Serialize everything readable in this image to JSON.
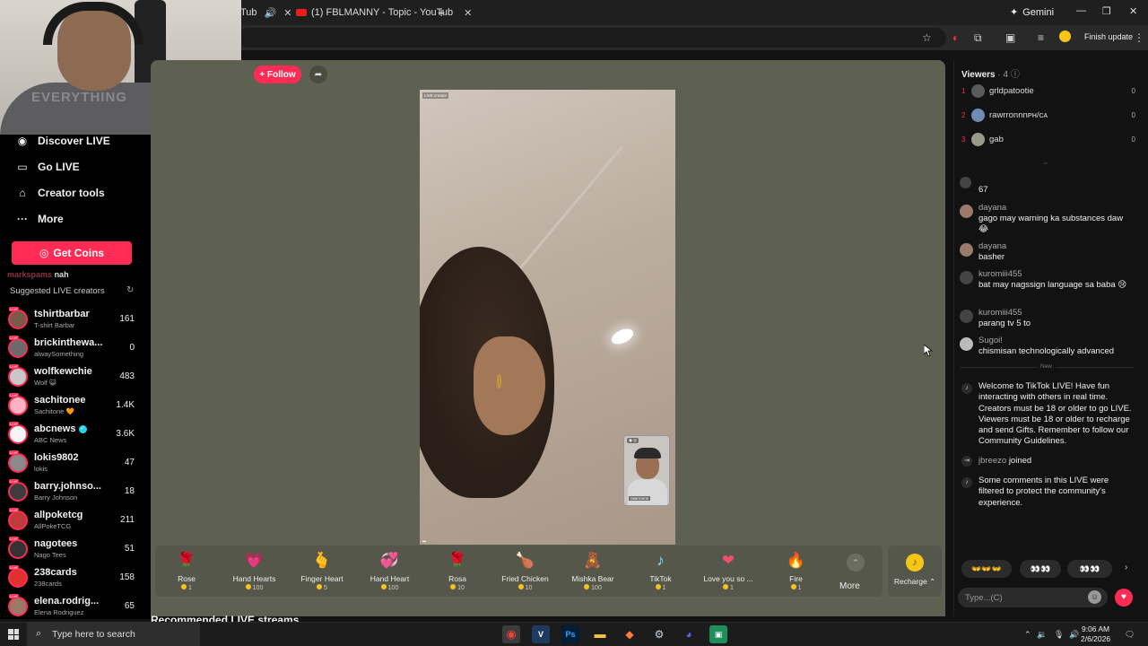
{
  "browser": {
    "tabs": [
      {
        "title": "Tub"
      },
      {
        "title": "(1) FBLMANNY - Topic - YouTub"
      }
    ],
    "gemini_label": "Gemini",
    "finish_update": "Finish update"
  },
  "sidebar": {
    "nav": [
      {
        "label": "Discover LIVE",
        "icon": "broadcast-icon"
      },
      {
        "label": "Go LIVE",
        "icon": "camera-icon"
      },
      {
        "label": "Creator tools",
        "icon": "home-icon"
      },
      {
        "label": "More",
        "icon": "more-icon"
      }
    ],
    "get_coins": "Get Coins",
    "handle_text": "marks",
    "handle_text_faded": "pams",
    "handle_text_end": "nah",
    "suggested_header": "Suggested LIVE creators",
    "live_badge": "LIVE",
    "creators": [
      {
        "name": "tshirtbarbar",
        "sub": "T-shirt Barbar",
        "count": "161"
      },
      {
        "name": "brickinthewa...",
        "sub": "alwaySomething",
        "count": "0"
      },
      {
        "name": "wolfkewchie",
        "sub": "Wolf 😺",
        "count": "483"
      },
      {
        "name": "sachitonee",
        "sub": "Sachitone 🧡",
        "count": "1.4K"
      },
      {
        "name": "abcnews",
        "sub": "ABC News",
        "count": "3.6K",
        "verified": true
      },
      {
        "name": "lokis9802",
        "sub": "lokis",
        "count": "47"
      },
      {
        "name": "barry.johnso...",
        "sub": "Barry Johnson",
        "count": "18"
      },
      {
        "name": "allpoketcg",
        "sub": "AllPokeTCG",
        "count": "211"
      },
      {
        "name": "nagotees",
        "sub": "Nago Tees",
        "count": "51"
      },
      {
        "name": "238cards",
        "sub": "238cards",
        "count": "158"
      },
      {
        "name": "elena.rodrig...",
        "sub": "Elena Rodriguez",
        "count": "65"
      }
    ]
  },
  "webcam": {
    "shirt_text": "EVERYTHING"
  },
  "stream": {
    "follow_label": "+ Follow",
    "video_label": "LIVE creator",
    "guest_top": "◉ ◎",
    "guest_name": "rawrronnn"
  },
  "gifts": [
    {
      "name": "Rose",
      "price": "1",
      "icon": "🌹"
    },
    {
      "name": "Hand Hearts",
      "price": "100",
      "icon": "💗"
    },
    {
      "name": "Finger Heart",
      "price": "5",
      "icon": "🫰"
    },
    {
      "name": "Hand Heart",
      "price": "100",
      "icon": "💞"
    },
    {
      "name": "Rosa",
      "price": "10",
      "icon": "🌹"
    },
    {
      "name": "Fried Chicken",
      "price": "10",
      "icon": "🍗"
    },
    {
      "name": "Mishka Bear",
      "price": "100",
      "icon": "🧸"
    },
    {
      "name": "TikTok",
      "price": "1",
      "icon": "♪"
    },
    {
      "name": "Love you so ...",
      "price": "1",
      "icon": "❤"
    },
    {
      "name": "Fire",
      "price": "1",
      "icon": "🔥"
    }
  ],
  "more_label": "More",
  "recharge_label": "Recharge ⌃",
  "recommended_label": "Recommended LIVE streams",
  "viewers": {
    "title": "Viewers",
    "count": "· 4",
    "list": [
      {
        "rank": "1",
        "name": "grldpatootie",
        "score": "0"
      },
      {
        "rank": "2",
        "name": "rawrronnnᴘʜ/ᴄᴀ",
        "score": "0"
      },
      {
        "rank": "3",
        "name": "gab",
        "score": "0"
      }
    ]
  },
  "chat": {
    "first_item": "67",
    "messages": [
      {
        "user": "dayana",
        "text": "gago may warning ka substances daw 😂"
      },
      {
        "user": "dayana",
        "text": "basher"
      },
      {
        "user": "kuromiii455",
        "text": "bat may nagssign language sa baba 😢"
      },
      {
        "user": "kuromiii455",
        "text": "parang tv 5 to"
      },
      {
        "user": "Sugoi!",
        "text": "chismisan technologically advanced"
      }
    ],
    "new_label": "New",
    "welcome": "Welcome to TikTok LIVE! Have fun interacting with others in real time. Creators must be 18 or older to go LIVE. Viewers must be 18 or older to recharge and send Gifts. Remember to follow our Community Guidelines.",
    "joined_user": "jbreezo",
    "joined_label": "joined",
    "filtered": "Some comments in this LIVE were filtered to protect the community's experience.",
    "quick_replies": [
      "👐👐👐",
      "👀👀",
      "👀👀"
    ],
    "input_placeholder": "Type...(C)"
  },
  "taskbar": {
    "search_placeholder": "Type here to search",
    "time": "9:06 AM",
    "date": "2/6/2026"
  }
}
